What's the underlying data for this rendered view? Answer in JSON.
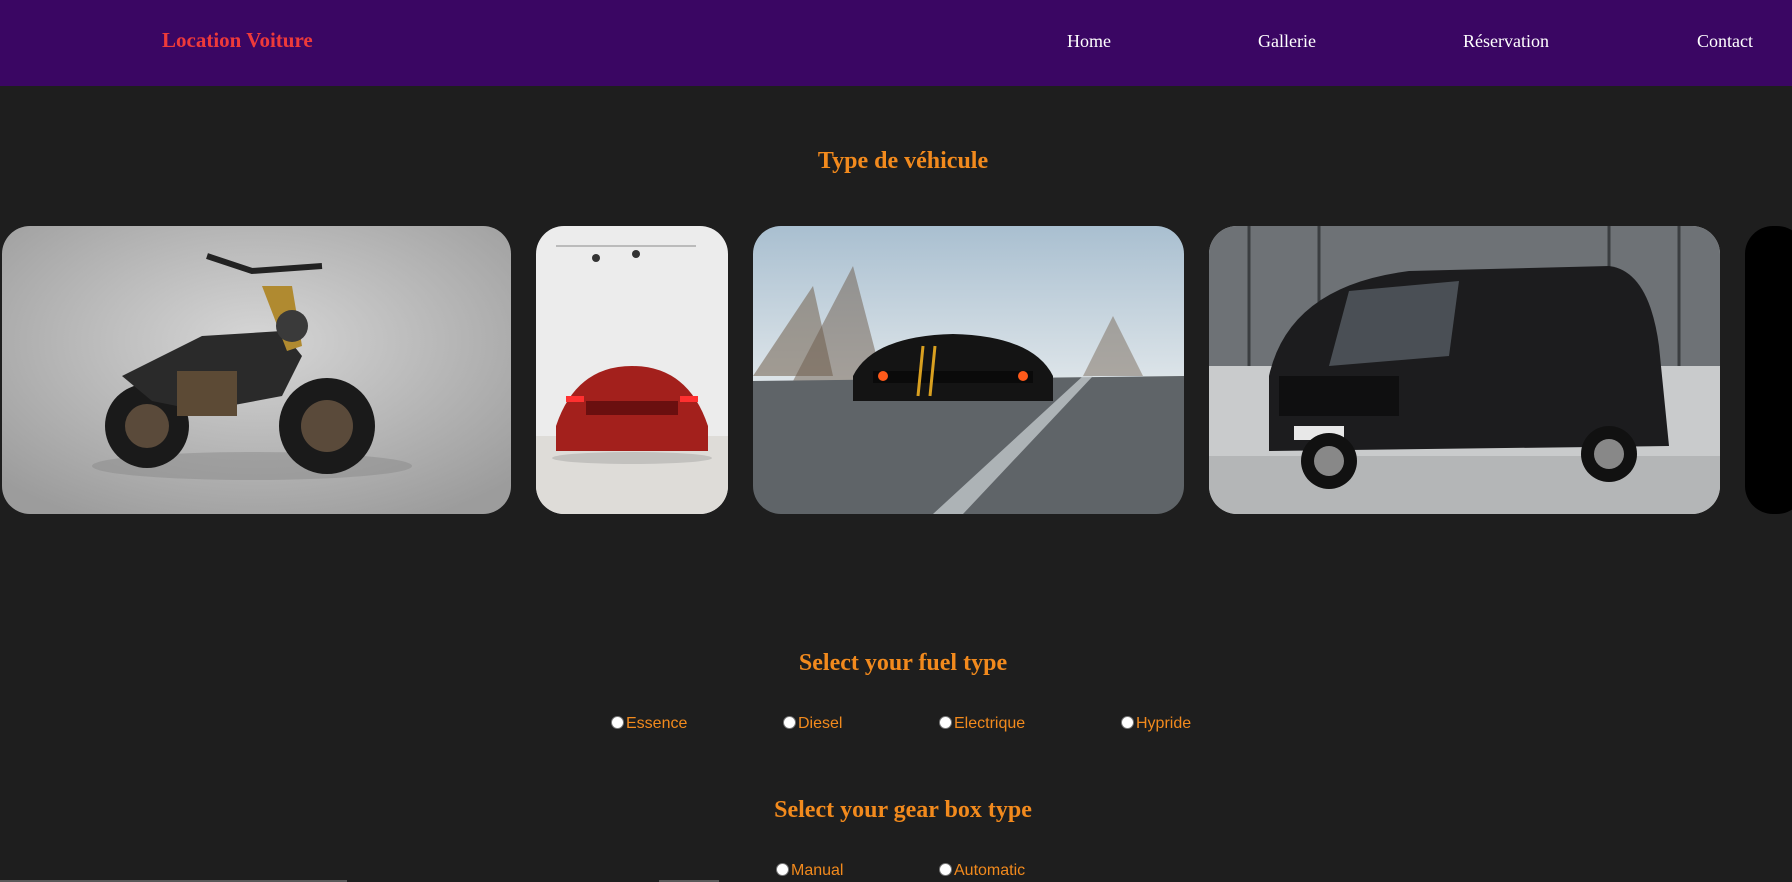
{
  "navbar": {
    "brand": "Location Voiture",
    "links": [
      "Home",
      "Gallerie",
      "Réservation",
      "Contact"
    ],
    "background": "#3a0663",
    "brand_color": "#ee3a3a"
  },
  "vehicle_section": {
    "title": "Type de véhicule",
    "images": [
      "motorcycle",
      "red-sports-car",
      "black-muscle-car",
      "black-van",
      "dark-vehicle-partial"
    ]
  },
  "fuel_section": {
    "title": "Select your fuel type",
    "options": [
      "Essence",
      "Diesel",
      "Electrique",
      "Hypride"
    ]
  },
  "gearbox_section": {
    "title": "Select your gear box type",
    "options": [
      "Manual",
      "Automatic"
    ]
  },
  "colors": {
    "page_bg": "#1e1e1e",
    "accent": "#f28a1d"
  }
}
